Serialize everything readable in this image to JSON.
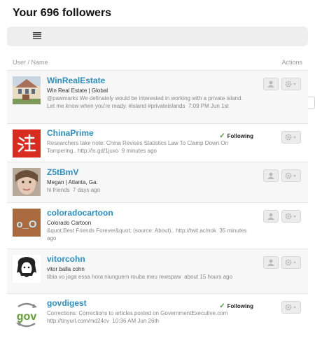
{
  "page": {
    "title": "Your 696 followers"
  },
  "columns": {
    "left": "User / Name",
    "right": "Actions"
  },
  "view_toggle": {
    "list_icon": "list-view-icon",
    "compact_icon": "compact-view-icon"
  },
  "colors": {
    "handle": "#2b8fc2",
    "following_check": "#46a036",
    "row_alt": "#f7f7f7"
  },
  "followers": [
    {
      "handle": "WinRealEstate",
      "name": "Win Real Estate | Global",
      "tweet": "@pawmarks We definately would be interested in working with a private island. Let me know when you're ready. #island #privateislands",
      "time": "7:09 PM Jun 1st",
      "following": "",
      "avatar_icon": "house-photo-icon"
    },
    {
      "handle": "ChinaPrime",
      "name": "",
      "tweet": "Researchers take note: China Revises Statistics Law To Clamp Down On Tampering.. http://is.gd/1juxo",
      "time": "9 minutes ago",
      "following": "Following",
      "avatar_icon": "china-logo-icon"
    },
    {
      "handle": "Z5tBmV",
      "name": "Megan | Atlanta, Ga.",
      "tweet": "hi friends",
      "time": "7 days ago",
      "following": "",
      "avatar_icon": "face-photo-icon"
    },
    {
      "handle": "coloradocartoon",
      "name": "Colorado Cartoon",
      "tweet": "&quot;Best Friends Forever&quot; (source: About).. http://twit.ac/nok",
      "time": "35 minutes ago",
      "following": "",
      "avatar_icon": "o-underscore-o-icon"
    },
    {
      "handle": "vitorcohn",
      "name": "vitor balla cohn",
      "tweet": "tibia vo joga essa hora niunguem rouba meu rewspaw",
      "time": "about 15 hours ago",
      "following": "",
      "avatar_icon": "sketch-face-icon"
    },
    {
      "handle": "govdigest",
      "name": "",
      "tweet": "Corrections: Corrections to articles posted on GovernmentExecutive.com http://tinyurl.com/md24cv",
      "time": "10:36 AM Jun 26th",
      "following": "Following",
      "avatar_icon": "gov-logo-icon"
    }
  ]
}
